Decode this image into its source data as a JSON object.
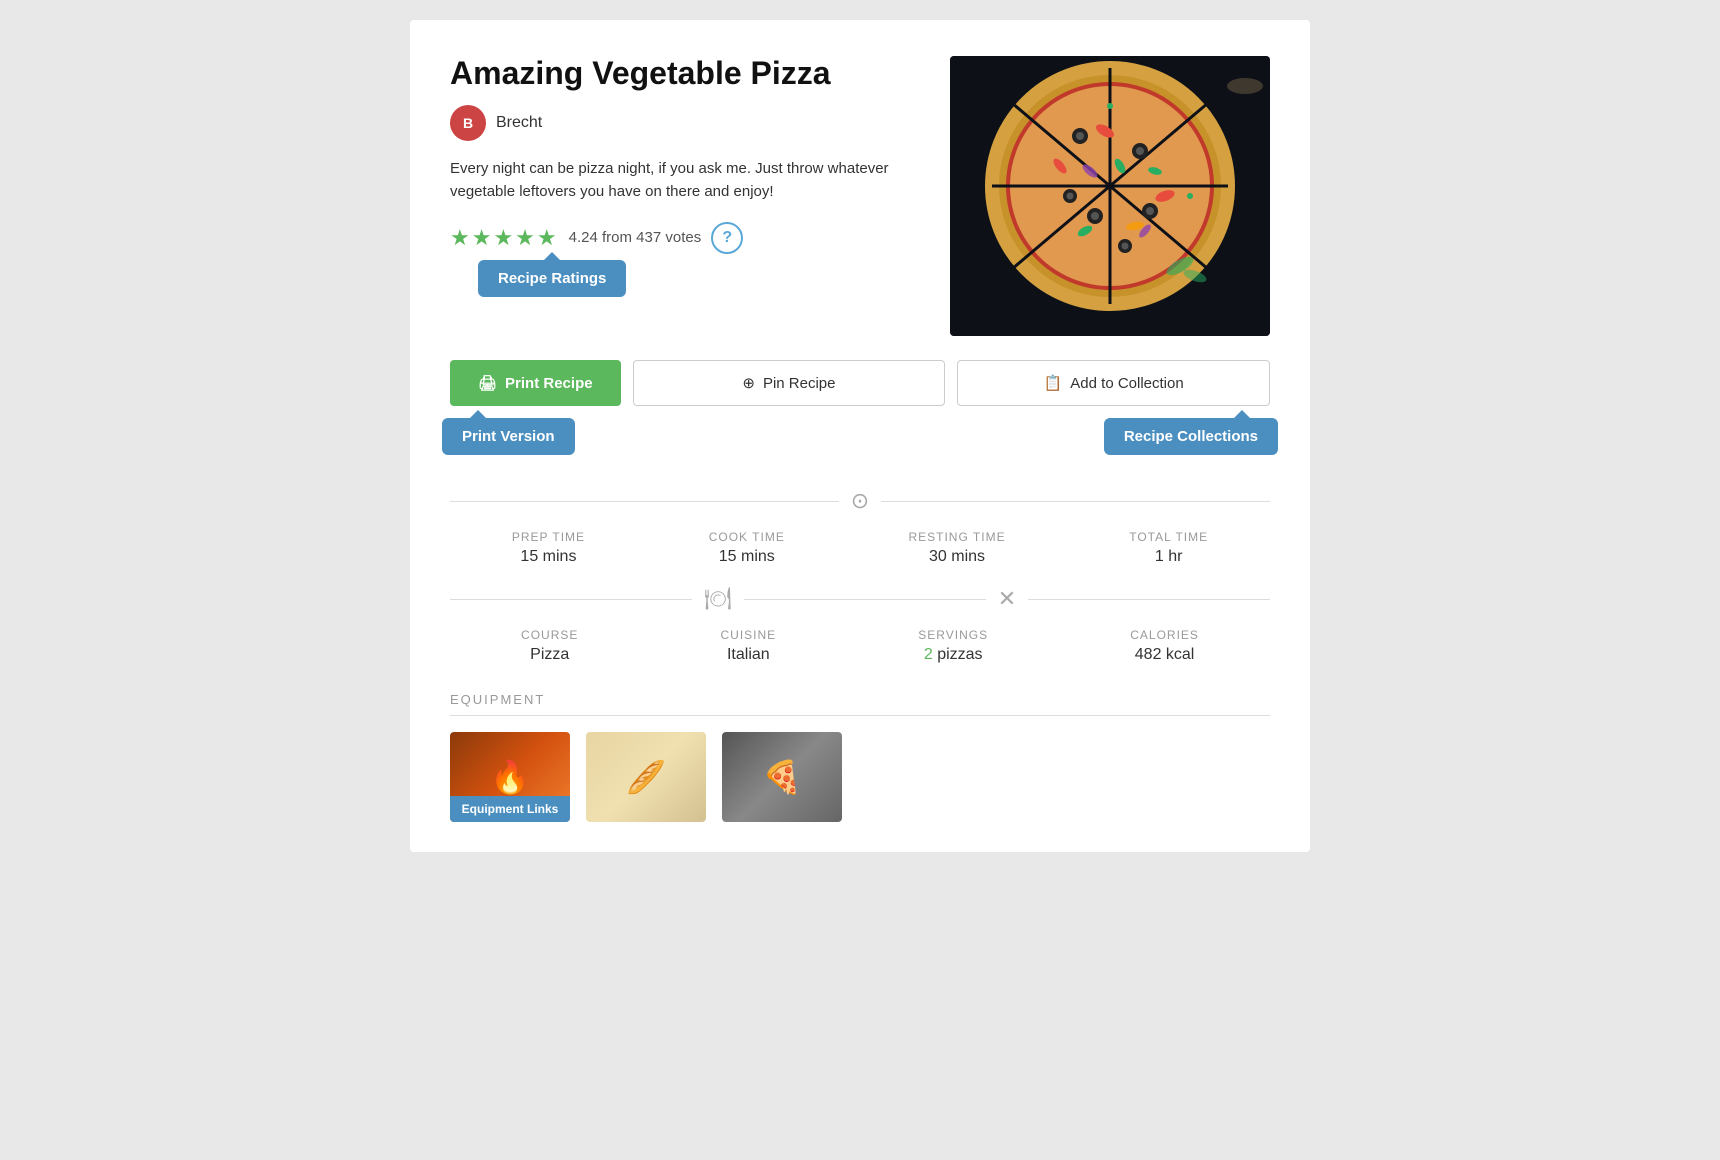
{
  "recipe": {
    "title": "Amazing Vegetable Pizza",
    "author": "Brecht",
    "description": "Every night can be pizza night, if you ask me. Just throw whatever vegetable leftovers you have on there and enjoy!",
    "rating": {
      "stars": 4.24,
      "star_display": "★★★★★",
      "text": "4.24 from 437 votes"
    },
    "tooltips": {
      "recipe_ratings": "Recipe Ratings",
      "print_version": "Print Version",
      "recipe_collections": "Recipe Collections",
      "equipment_links": "Equipment Links"
    },
    "buttons": {
      "print": "Print Recipe",
      "pin": "Pin Recipe",
      "add_to_collection": "Add to Collection"
    },
    "times": {
      "prep_label": "PREP TIME",
      "prep_value": "15 mins",
      "cook_label": "COOK TIME",
      "cook_value": "15 mins",
      "resting_label": "RESTING TIME",
      "resting_value": "30 mins",
      "total_label": "TOTAL TIME",
      "total_value": "1 hr"
    },
    "details": {
      "course_label": "COURSE",
      "course_value": "Pizza",
      "cuisine_label": "CUISINE",
      "cuisine_value": "Italian",
      "servings_label": "SERVINGS",
      "servings_value": "2 pizzas",
      "servings_number": "2",
      "calories_label": "CALORIES",
      "calories_value": "482 kcal"
    },
    "equipment_title": "EQUIPMENT"
  }
}
